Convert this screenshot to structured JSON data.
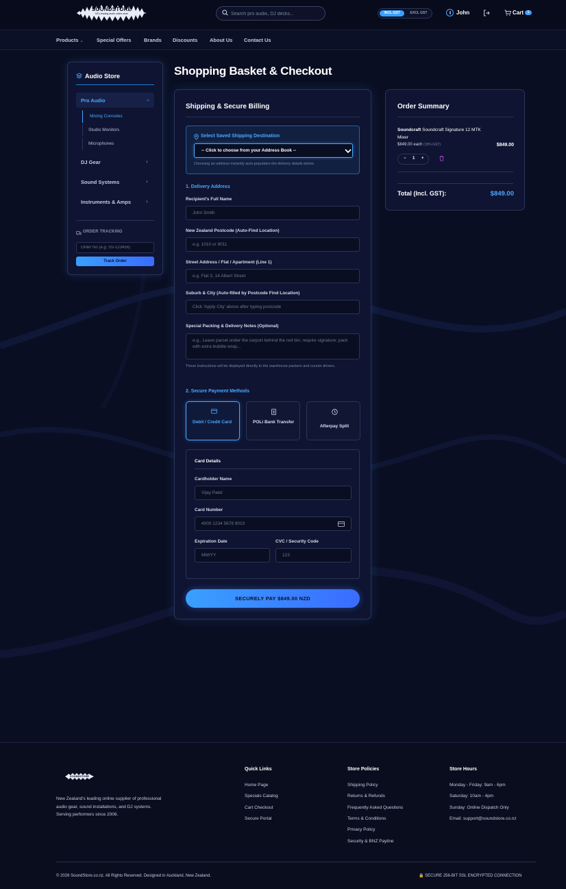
{
  "header": {
    "logo_text": "SOUNDSTORE",
    "logo_tagline": "NZ's leading audio online store",
    "search_placeholder": "Search pro audio, DJ decks...",
    "gst_incl": "INCL GST",
    "gst_excl": "EXCL GST",
    "user_name": "John",
    "cart_label": "Cart",
    "cart_count": "1"
  },
  "nav": {
    "items": [
      "Products",
      "Special Offers",
      "Brands",
      "Discounts",
      "About Us",
      "Contact Us"
    ]
  },
  "sidebar": {
    "title": "Audio Store",
    "active_category": "Pro Audio",
    "subcategories": [
      "Mixing Consoles",
      "Studio Monitors",
      "Microphones"
    ],
    "categories": [
      "DJ Gear",
      "Sound Systems",
      "Instruments & Amps"
    ],
    "order_tracking_title": "ORDER TRACKING",
    "order_placeholder": "Order No (e.g. SS-123456)",
    "track_button": "Track Order"
  },
  "page_title": "Shopping Basket & Checkout",
  "checkout": {
    "panel_title": "Shipping & Secure Billing",
    "saved_title": "Select Saved Shipping Destination",
    "saved_select": "-- Click to choose from your Address Book --",
    "saved_help": "Choosing an address instantly auto-populates the delivery details below.",
    "section1": "1. Delivery Address",
    "name_label": "Recipient's Full Name",
    "name_placeholder": "John Smith",
    "postcode_label": "New Zealand Postcode (Auto-Find Location)",
    "postcode_placeholder": "e.g. 1010 or 8011",
    "street_label": "Street Address / Flat / Apartment (Line 1)",
    "street_placeholder": "e.g. Flat 3, 14 Albert Street",
    "suburb_label": "Suburb & City (Auto-filled by Postcode Find Location)",
    "suburb_placeholder": "Click 'Apply City' above after typing postcode",
    "notes_label": "Special Packing & Delivery Notes (Optional)",
    "notes_placeholder": "e.g., Leave parcel under the carport behind the red bin; require signature; pack with extra bubble wrap...",
    "notes_help": "These instructions will be displayed directly to the warehouse packers and courier drivers.",
    "section2": "2. Secure Payment Methods",
    "pay_methods": [
      "Debit / Credit Card",
      "POLi Bank Transfer",
      "Afterpay Split"
    ],
    "card_title": "Card Details",
    "holder_label": "Cardholder Name",
    "holder_placeholder": "Vijay Patel",
    "number_label": "Card Number",
    "number_placeholder": "4000 1234 5678 9010",
    "expiry_label": "Expiration Date",
    "expiry_placeholder": "MM/YY",
    "cvc_label": "CVC / Security Code",
    "cvc_placeholder": "123",
    "pay_button": "SECURELY PAY $849.00 NZD"
  },
  "summary": {
    "title": "Order Summary",
    "item_brand": "Soundcraft",
    "item_name": "Soundcraft Signature 12 MTK Mixer",
    "unit_price": "$849.00 each",
    "gst_note": "(15% GST)",
    "line_total": "$849.00",
    "qty": "1",
    "qty_minus": "−",
    "qty_plus": "+",
    "total_label": "Total (Incl. GST):",
    "total_value": "$849.00"
  },
  "footer": {
    "logo_text": "SOUNDSTORE",
    "description": "New Zealand's leading online supplier of professional audio gear, sound installations, and DJ systems. Serving performers since 2006.",
    "quick_links_title": "Quick Links",
    "quick_links": [
      "Home Page",
      "Specials Catalog",
      "Cart Checkout",
      "Secure Portal"
    ],
    "policies_title": "Store Policies",
    "policies": [
      "Shipping Policy",
      "Returns & Refunds",
      "Frequently Asked Questions",
      "Terms & Conditions",
      "Privacy Policy",
      "Security & BNZ Payline"
    ],
    "hours_title": "Store Hours",
    "hours": [
      "Monday - Friday: 9am - 6pm",
      "Saturday: 10am - 4pm",
      "Sunday: Online Dispatch Only",
      "Email: support@soundstore.co.nz"
    ],
    "copyright": "© 2026 SoundStore.co.nz. All Rights Reserved. Designed in Auckland, New Zealand.",
    "secure": "SECURE 256-BIT SSL ENCRYPTED CONNECTION"
  },
  "colors": {
    "background": "#0a0e22",
    "accent": "#3aa0ff",
    "panel": "#0e1431"
  }
}
